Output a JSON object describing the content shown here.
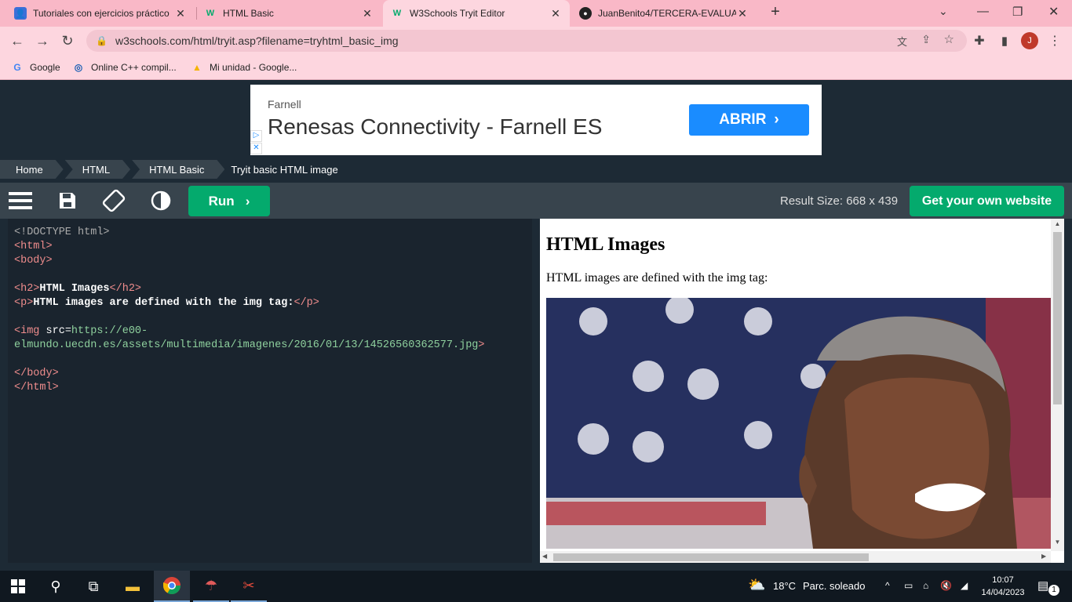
{
  "browser": {
    "tabs": [
      {
        "title": "Tutoriales con ejercicios práctico",
        "icon": "profile-icon",
        "active": false
      },
      {
        "title": "HTML Basic",
        "icon": "w3schools-icon",
        "active": false
      },
      {
        "title": "W3Schools Tryit Editor",
        "icon": "w3schools-icon",
        "active": true
      },
      {
        "title": "JuanBenito4/TERCERA-EVALUACI",
        "icon": "github-icon",
        "active": false
      }
    ],
    "new_tab": "+",
    "url": "w3schools.com/html/tryit.asp?filename=tryhtml_basic_img",
    "avatar_letter": "J",
    "bookmarks": [
      {
        "label": "Google",
        "icon": "google-icon"
      },
      {
        "label": "Online C++ compil...",
        "icon": "compiler-icon"
      },
      {
        "label": "Mi unidad - Google...",
        "icon": "drive-icon"
      }
    ]
  },
  "ad": {
    "advertiser": "Farnell",
    "headline": "Renesas Connectivity - Farnell ES",
    "cta": "ABRIR"
  },
  "breadcrumb": [
    "Home",
    "HTML",
    "HTML Basic",
    "Tryit basic HTML image"
  ],
  "editor_toolbar": {
    "run_label": "Run",
    "result_size": "Result Size: 668 x 439",
    "get_website_label": "Get your own website"
  },
  "code": {
    "doctype": "<!DOCTYPE html>",
    "html_open": "<html>",
    "body_open": "<body>",
    "h2_open": "<h2>",
    "h2_text": "HTML Images",
    "h2_close": "</h2>",
    "p_open": "<p>",
    "p_text": "HTML images are defined with the img tag:",
    "p_close": "</p>",
    "img_tag": "<img",
    "img_attr": "src=",
    "img_src_1": "https://e00-",
    "img_src_2": "elmundo.uecdn.es/assets/multimedia/imagenes/2016/01/13/14526560362577.jpg",
    "img_close": ">",
    "body_close": "</body>",
    "html_close": "</html>"
  },
  "result": {
    "heading": "HTML Images",
    "paragraph": "HTML images are defined with the img tag:"
  },
  "taskbar": {
    "weather_temp": "18°C",
    "weather_desc": "Parc. soleado",
    "time": "10:07",
    "date": "14/04/2023",
    "notifications": "1"
  }
}
